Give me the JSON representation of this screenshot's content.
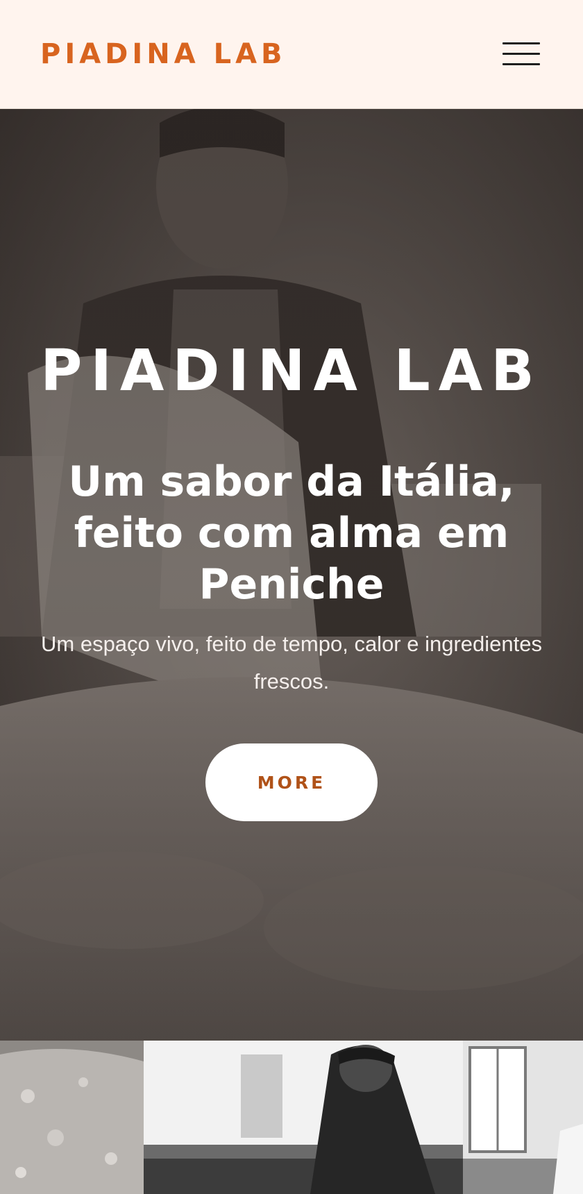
{
  "header": {
    "logo_text": "PIADINA LAB",
    "menu_icon": "hamburger-menu-icon"
  },
  "hero": {
    "brand": "PIADINA LAB",
    "title": "Um sabor da Itália, feito com alma em Peniche",
    "subtitle": "Um espaço vivo, feito de tempo, calor e ingredientes frescos.",
    "button_label": "MORE"
  },
  "colors": {
    "brand_orange": "#d8641f",
    "button_text": "#b05218",
    "header_bg": "#fff4ee",
    "hero_text": "#ffffff"
  },
  "gallery": {
    "images": [
      "flour-texture-photo",
      "chef-at-window-photo",
      "kitchen-window-photo"
    ]
  }
}
